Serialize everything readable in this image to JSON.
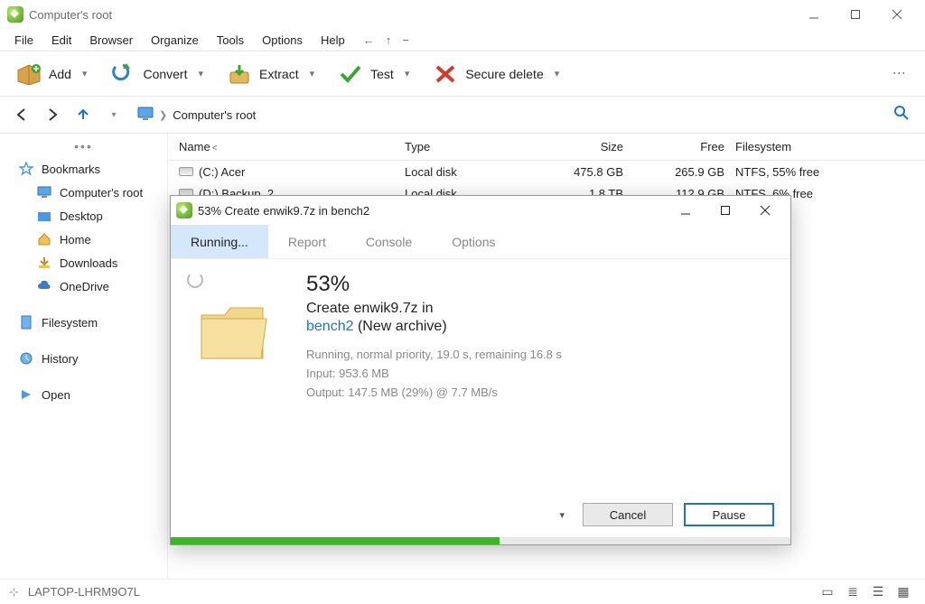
{
  "window": {
    "title": "Computer's root",
    "statusbar_host": "LAPTOP-LHRM9O7L"
  },
  "menu": [
    "File",
    "Edit",
    "Browser",
    "Organize",
    "Tools",
    "Options",
    "Help"
  ],
  "toolbar": {
    "add": "Add",
    "convert": "Convert",
    "extract": "Extract",
    "test": "Test",
    "secure_delete": "Secure delete"
  },
  "breadcrumb": {
    "label": "Computer's root"
  },
  "sidebar": {
    "bookmarks": "Bookmarks",
    "items": [
      {
        "label": "Computer's root",
        "icon": "monitor"
      },
      {
        "label": "Desktop",
        "icon": "folder-blue"
      },
      {
        "label": "Home",
        "icon": "home"
      },
      {
        "label": "Downloads",
        "icon": "download"
      },
      {
        "label": "OneDrive",
        "icon": "cloud"
      }
    ],
    "filesystem": "Filesystem",
    "history": "History",
    "open": "Open"
  },
  "columns": {
    "name": "Name",
    "type": "Type",
    "size": "Size",
    "free": "Free",
    "filesystem": "Filesystem",
    "sort_indicator": "<"
  },
  "rows": [
    {
      "name": "(C:) Acer",
      "type": "Local disk",
      "size": "475.8 GB",
      "free": "265.9 GB",
      "fs": "NTFS, 55% free"
    },
    {
      "name": "(D:) Backup_2",
      "type": "Local disk",
      "size": "1.8 TB",
      "free": "112.9 GB",
      "fs": "NTFS, 6% free"
    }
  ],
  "dialog": {
    "title": "53% Create enwik9.7z in bench2",
    "tabs": {
      "running": "Running...",
      "report": "Report",
      "console": "Console",
      "options": "Options"
    },
    "percent": "53%",
    "line1": "Create enwik9.7z in",
    "path_link": "bench2",
    "path_suffix": "(New archive)",
    "status1": "Running, normal priority, 19.0 s, remaining 16.8 s",
    "status2": "Input: 953.6 MB",
    "status3": "Output: 147.5 MB (29%) @ 7.7 MB/s",
    "cancel": "Cancel",
    "pause": "Pause",
    "progress_percent": 53
  }
}
